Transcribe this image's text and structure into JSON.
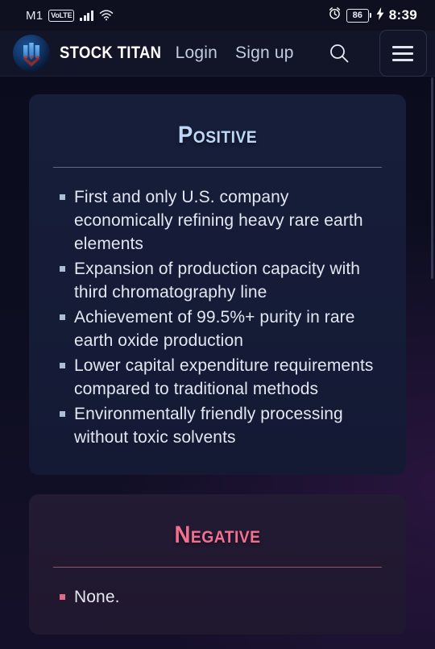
{
  "statusbar": {
    "carrier": "M1",
    "network_badge": "VoLTE",
    "signal_icon": "signal-bars-icon",
    "wifi_icon": "wifi-icon",
    "alarm_icon": "alarm-clock-icon",
    "battery_level": "86",
    "charging_icon": "charging-bolt-icon",
    "time": "8:39"
  },
  "header": {
    "logo_icon": "stock-titan-logo-icon",
    "brand_name": "STOCK TITAN",
    "login_label": "Login",
    "signup_label": "Sign up",
    "search_icon": "search-icon",
    "menu_icon": "hamburger-menu-icon"
  },
  "cards": [
    {
      "title": "Positive",
      "accent": "#bcd8f5",
      "items": [
        "First and only U.S. company economically refining heavy rare earth elements",
        "Expansion of production capacity with third chromatography line",
        "Achievement of 99.5%+ purity in rare earth oxide production",
        "Lower capital expenditure requirements compared to traditional methods",
        "Environmentally friendly processing without toxic solvents"
      ]
    },
    {
      "title": "Negative",
      "accent": "#f2708f",
      "items": [
        "None."
      ]
    }
  ]
}
